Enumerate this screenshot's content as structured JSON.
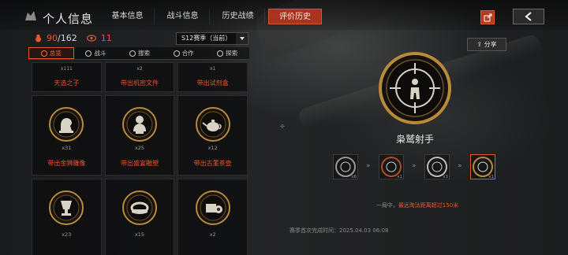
{
  "header": {
    "title": "个人信息",
    "tabs": [
      {
        "label": "基本信息",
        "active": false
      },
      {
        "label": "战斗信息",
        "active": false
      },
      {
        "label": "历史战绩",
        "active": false
      },
      {
        "label": "评价历史",
        "active": true
      }
    ],
    "accent_color": "#a8341e",
    "icons": [
      "logo-icon",
      "share-export-icon",
      "back-icon"
    ]
  },
  "stats": {
    "medals_owned": "90",
    "medals_total": "/162",
    "views": "11"
  },
  "season_select": {
    "value": "S12赛季（当前）"
  },
  "subtabs": [
    {
      "label": "总览",
      "active": true
    },
    {
      "label": "战斗",
      "active": false
    },
    {
      "label": "搜索",
      "active": false
    },
    {
      "label": "合作",
      "active": false
    },
    {
      "label": "探索",
      "active": false
    }
  ],
  "top_row": [
    {
      "count": "x111",
      "label": "天选之子"
    },
    {
      "count": "x2",
      "label": "带出机密文件"
    },
    {
      "count": "x1",
      "label": "带出试剂盒"
    }
  ],
  "rows": [
    [
      {
        "count": "x31",
        "label": "带出金狮雕像",
        "icon": "lion-statue-icon"
      },
      {
        "count": "x25",
        "label": "带出盛宴雕塑",
        "icon": "bust-statue-icon"
      },
      {
        "count": "x12",
        "label": "带出古董茶壶",
        "icon": "teapot-icon"
      }
    ],
    [
      {
        "count": "x23",
        "label": "",
        "icon": "trophy-vase-icon"
      },
      {
        "count": "x15",
        "label": "",
        "icon": "crown-icon"
      },
      {
        "count": "x2",
        "label": "",
        "icon": "camera-icon"
      }
    ]
  ],
  "detail": {
    "share_label": "分享",
    "medal_name": "枭鹫射手",
    "progression": [
      {
        "count": "x6",
        "active": false
      },
      {
        "count": "x1",
        "active": false
      },
      {
        "count": "x3",
        "active": false
      },
      {
        "count": "x1",
        "active": true
      }
    ],
    "desc_prefix": "一局中，",
    "desc_highlight": "最远淘汰距离超过150米",
    "first_complete": "赛季首次完成时间：2025.04.03 06:08"
  }
}
